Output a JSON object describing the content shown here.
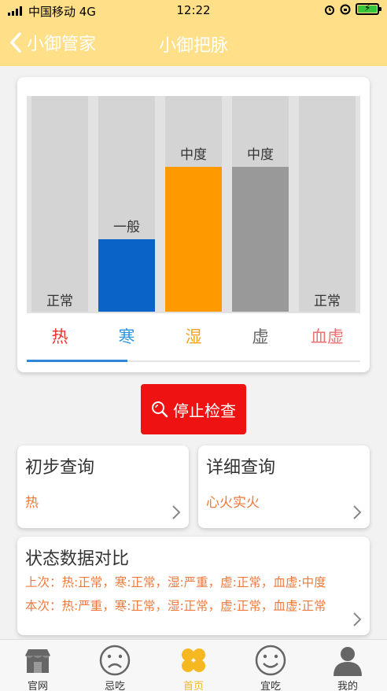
{
  "status": {
    "carrier": "中国移动 4G",
    "time": "12:22"
  },
  "header": {
    "back_label": "小御管家",
    "title": "小御把脉"
  },
  "chart_data": {
    "type": "bar",
    "categories": [
      "热",
      "寒",
      "湿",
      "虚",
      "血虚"
    ],
    "levels": [
      "正常",
      "一般",
      "中度",
      "中度",
      "正常"
    ],
    "values": [
      0,
      1,
      2,
      2,
      0
    ],
    "ylim": [
      0,
      3
    ],
    "colors": [
      "#d4d4d4",
      "#0a64c8",
      "#ff9900",
      "#999999",
      "#d4d4d4"
    ],
    "tab_colors": [
      "#ee3333",
      "#2d96e0",
      "#f2a51e",
      "#666666",
      "#ef6f6f"
    ],
    "selected_index": 0
  },
  "stop_button": {
    "label": "停止检查",
    "icon": "magnifier-icon"
  },
  "preliminary": {
    "title": "初步查询",
    "value": "热"
  },
  "detailed": {
    "title": "详细查询",
    "value": "心火实火"
  },
  "compare": {
    "title": "状态数据对比",
    "last": "上次：热:正常，寒:正常，湿:严重，虚:正常，血虚:中度",
    "current": "本次：热:严重，寒:正常，湿:正常，虚:正常，血虚:正常"
  },
  "tabbar": {
    "items": [
      {
        "label": "官网",
        "icon": "shop-icon"
      },
      {
        "label": "忌吃",
        "icon": "sad-face-icon"
      },
      {
        "label": "首页",
        "icon": "clover-icon"
      },
      {
        "label": "宜吃",
        "icon": "happy-face-icon"
      },
      {
        "label": "我的",
        "icon": "user-icon"
      }
    ],
    "active_index": 2,
    "active_color": "#f5b820"
  }
}
